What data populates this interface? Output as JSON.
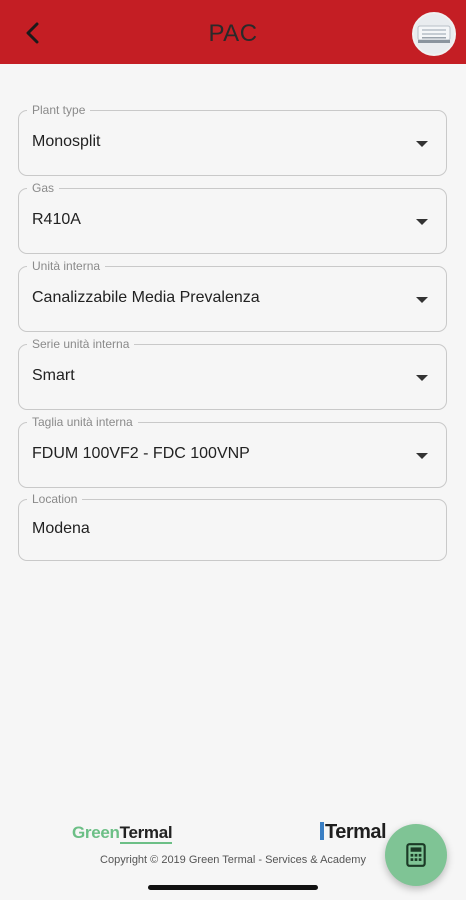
{
  "header": {
    "title": "PAC",
    "back_icon": "chevron-left-icon",
    "thumbnail_icon": "air-conditioner-unit-icon",
    "color": "#c41e24"
  },
  "form": {
    "fields": [
      {
        "label": "Plant type",
        "value": "Monosplit",
        "dropdown": true
      },
      {
        "label": "Gas",
        "value": "R410A",
        "dropdown": true
      },
      {
        "label": "Unità interna",
        "value": "Canalizzabile Media Prevalenza",
        "dropdown": true
      },
      {
        "label": "Serie unità interna",
        "value": "Smart",
        "dropdown": true
      },
      {
        "label": "Taglia unità interna",
        "value": "FDUM 100VF2 - FDC 100VNP",
        "dropdown": true
      },
      {
        "label": "Location",
        "value": "Modena",
        "dropdown": false
      }
    ]
  },
  "footer": {
    "logo_green_part1": "Green",
    "logo_green_part2": "Termal",
    "logo_termal": "Termal",
    "copyright": "Copyright © 2019 Green Termal - Services & Academy",
    "accent_green": "#6cbf86"
  },
  "fab": {
    "icon": "calculator-icon",
    "color": "#7fc495"
  }
}
